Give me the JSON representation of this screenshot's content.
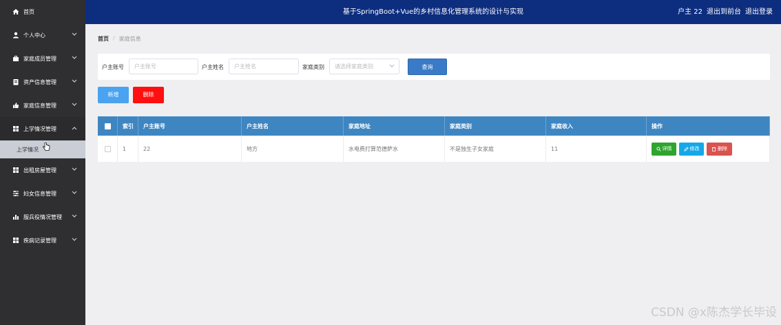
{
  "header": {
    "title": "基于SpringBoot+Vue的乡村信息化管理系统的设计与实现",
    "user": "户主 22",
    "back_front": "退出到前台",
    "logout": "退出登录"
  },
  "sidebar": {
    "items": [
      {
        "label": "首页",
        "icon": "home-icon"
      },
      {
        "label": "个人中心",
        "icon": "user-icon"
      },
      {
        "label": "家庭成员管理",
        "icon": "briefcase-icon"
      },
      {
        "label": "资产信息管理",
        "icon": "document-icon"
      },
      {
        "label": "家庭信息管理",
        "icon": "thumb-icon"
      },
      {
        "label": "上学情况管理",
        "icon": "grid-icon",
        "sub": "上学情况"
      },
      {
        "label": "出租房屋管理",
        "icon": "grid-icon"
      },
      {
        "label": "妇女信息管理",
        "icon": "sliders-icon"
      },
      {
        "label": "服兵役情况管理",
        "icon": "bar-chart-icon"
      },
      {
        "label": "疾病记录管理",
        "icon": "grid-icon"
      }
    ]
  },
  "breadcrumb": {
    "home": "首页",
    "current": "家庭信息"
  },
  "search": {
    "account_label": "户主账号",
    "account_placeholder": "户主账号",
    "name_label": "户主姓名",
    "name_placeholder": "户主姓名",
    "type_label": "家庭类别",
    "type_placeholder": "请选择家庭类别",
    "query_button": "查询"
  },
  "actions": {
    "add": "新增",
    "delete": "删除"
  },
  "table": {
    "columns": [
      "索引",
      "户主账号",
      "户主姓名",
      "家庭地址",
      "家庭类别",
      "家庭收入",
      "操作"
    ],
    "rows": [
      {
        "index": "1",
        "account": "22",
        "name": "地方",
        "address": "水电费打算范德萨水",
        "type": "不是独生子女家庭",
        "income": "11"
      }
    ],
    "row_actions": {
      "detail": "详情",
      "edit": "修改",
      "remove": "删除"
    }
  },
  "watermark": "CSDN @x陈杰学长毕设",
  "colors": {
    "header_bg": "#0d2d7f",
    "sidebar_bg": "#2f2f31",
    "table_header_bg": "#3e86c2",
    "add_button": "#4aa3f0",
    "delete_button": "#ff1010",
    "detail_button": "#2ea52e",
    "edit_button": "#14a8e8",
    "remove_button": "#d9534f"
  }
}
